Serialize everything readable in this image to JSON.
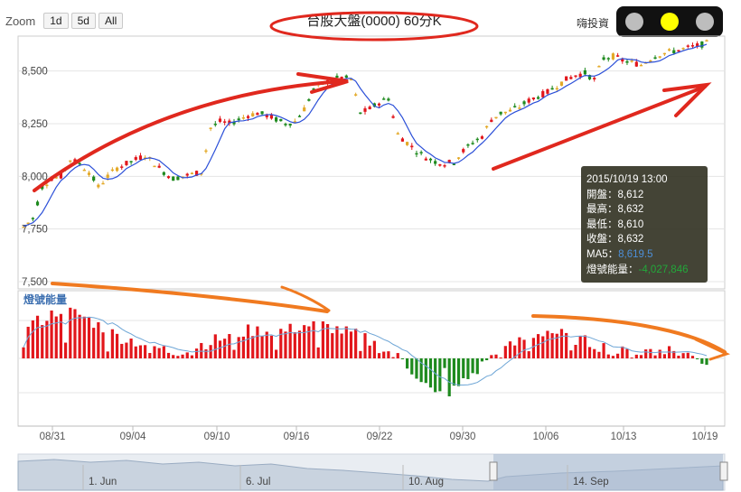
{
  "zoom": {
    "label": "Zoom",
    "buttons": [
      "1d",
      "5d",
      "All"
    ]
  },
  "title": "台股大盤(0000) 60分K",
  "signal": {
    "label": "嗨投資",
    "lights": [
      "#bdbdbd",
      "#ffff00",
      "#bdbdbd"
    ]
  },
  "colors": {
    "up": "#e2161b",
    "down": "#1e8a1e",
    "flat": "#e3a928",
    "ma": "#2b4fd8",
    "vol_ma": "#6ea6d6",
    "annotation": "#e0281e",
    "arrow_orange": "#f07a20",
    "nav_fill": "#a6b8cf"
  },
  "tooltip": {
    "date": "2015/10/19 13:00",
    "open_label": "開盤：",
    "open": "8,612",
    "high_label": "最高：",
    "high": "8,632",
    "low_label": "最低：",
    "low": "8,610",
    "close_label": "收盤：",
    "close": "8,632",
    "ma5_label": "MA5：",
    "ma5": "8,619.5",
    "vol_label": "燈號能量：",
    "vol": "-4,027,846"
  },
  "chart_data": {
    "type": "candlestick",
    "title": "台股大盤(0000) 60分K",
    "y_ticks": [
      "8,500",
      "8,250",
      "8,000",
      "7,750",
      "7,500"
    ],
    "ylim": [
      7500,
      8700
    ],
    "x_ticks": [
      "08/31",
      "09/04",
      "09/10",
      "09/16",
      "09/22",
      "09/30",
      "10/06",
      "10/13",
      "10/19"
    ],
    "volume_label": "燈號能量",
    "navigator_ticks": [
      "1. Jun",
      "6. Jul",
      "10. Aug",
      "14. Sep"
    ],
    "price_path": [
      [
        0,
        7760
      ],
      [
        2,
        7800
      ],
      [
        4,
        7950
      ],
      [
        6,
        7990
      ],
      [
        8,
        8000
      ],
      [
        10,
        8080
      ],
      [
        12,
        8060
      ],
      [
        14,
        8020
      ],
      [
        16,
        7950
      ],
      [
        18,
        8000
      ],
      [
        20,
        8040
      ],
      [
        22,
        8060
      ],
      [
        24,
        8080
      ],
      [
        26,
        8100
      ],
      [
        28,
        8060
      ],
      [
        30,
        8020
      ],
      [
        32,
        7990
      ],
      [
        34,
        8000
      ],
      [
        36,
        8010
      ],
      [
        38,
        8020
      ],
      [
        40,
        8230
      ],
      [
        42,
        8260
      ],
      [
        44,
        8250
      ],
      [
        46,
        8270
      ],
      [
        48,
        8290
      ],
      [
        50,
        8300
      ],
      [
        52,
        8290
      ],
      [
        54,
        8270
      ],
      [
        56,
        8250
      ],
      [
        58,
        8260
      ],
      [
        60,
        8320
      ],
      [
        62,
        8410
      ],
      [
        64,
        8440
      ],
      [
        66,
        8460
      ],
      [
        68,
        8470
      ],
      [
        70,
        8460
      ],
      [
        72,
        8300
      ],
      [
        74,
        8320
      ],
      [
        76,
        8350
      ],
      [
        78,
        8370
      ],
      [
        80,
        8200
      ],
      [
        82,
        8160
      ],
      [
        84,
        8120
      ],
      [
        86,
        8090
      ],
      [
        88,
        8070
      ],
      [
        90,
        8060
      ],
      [
        92,
        8070
      ],
      [
        94,
        8120
      ],
      [
        96,
        8160
      ],
      [
        98,
        8190
      ],
      [
        100,
        8270
      ],
      [
        102,
        8300
      ],
      [
        104,
        8310
      ],
      [
        106,
        8330
      ],
      [
        108,
        8360
      ],
      [
        110,
        8380
      ],
      [
        112,
        8400
      ],
      [
        114,
        8430
      ],
      [
        116,
        8460
      ],
      [
        118,
        8480
      ],
      [
        120,
        8490
      ],
      [
        122,
        8460
      ],
      [
        124,
        8560
      ],
      [
        126,
        8570
      ],
      [
        128,
        8550
      ],
      [
        130,
        8540
      ],
      [
        132,
        8530
      ],
      [
        134,
        8560
      ],
      [
        136,
        8580
      ],
      [
        138,
        8590
      ],
      [
        140,
        8600
      ],
      [
        142,
        8610
      ],
      [
        144,
        8620
      ],
      [
        146,
        8632
      ]
    ],
    "volume_path": [
      [
        0,
        6
      ],
      [
        4,
        7
      ],
      [
        8,
        9
      ],
      [
        12,
        8
      ],
      [
        16,
        6
      ],
      [
        20,
        4
      ],
      [
        24,
        3
      ],
      [
        28,
        2
      ],
      [
        32,
        1
      ],
      [
        36,
        2
      ],
      [
        40,
        3
      ],
      [
        44,
        4
      ],
      [
        48,
        5
      ],
      [
        52,
        5
      ],
      [
        56,
        5
      ],
      [
        60,
        6
      ],
      [
        64,
        6
      ],
      [
        68,
        5
      ],
      [
        72,
        4
      ],
      [
        76,
        2
      ],
      [
        80,
        0
      ],
      [
        84,
        -3
      ],
      [
        88,
        -7
      ],
      [
        92,
        -6
      ],
      [
        96,
        -3
      ],
      [
        100,
        0
      ],
      [
        104,
        2
      ],
      [
        108,
        4
      ],
      [
        112,
        5
      ],
      [
        116,
        4
      ],
      [
        120,
        3
      ],
      [
        124,
        2
      ],
      [
        128,
        1
      ],
      [
        132,
        1
      ],
      [
        136,
        2
      ],
      [
        140,
        1
      ],
      [
        144,
        0
      ],
      [
        146,
        -1
      ]
    ]
  }
}
